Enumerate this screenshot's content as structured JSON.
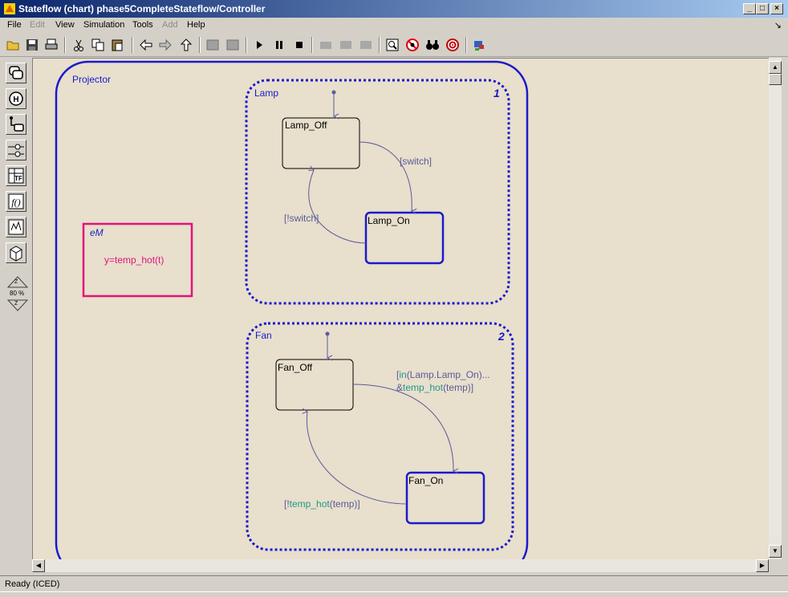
{
  "window": {
    "title": "Stateflow (chart) phase5CompleteStateflow/Controller",
    "minimize_glyph": "_",
    "maximize_glyph": "□",
    "close_glyph": "×"
  },
  "menu": {
    "items": [
      {
        "label": "File",
        "enabled": true
      },
      {
        "label": "Edit",
        "enabled": false
      },
      {
        "label": "View",
        "enabled": true
      },
      {
        "label": "Simulation",
        "enabled": true
      },
      {
        "label": "Tools",
        "enabled": true
      },
      {
        "label": "Add",
        "enabled": false
      },
      {
        "label": "Help",
        "enabled": true
      }
    ],
    "chevron": "↘"
  },
  "toolbar": {
    "icons": [
      "open-folder-icon",
      "save-icon",
      "print-icon",
      "cut-icon",
      "copy-icon",
      "paste-icon",
      "back-arrow-icon",
      "forward-arrow-icon",
      "up-arrow-icon",
      "build-icon",
      "rebuild-icon",
      "start-icon",
      "pause-icon",
      "stop-icon",
      "debug-icon",
      "explore-icon",
      "target-icon",
      "find-icon",
      "stop-sign-icon",
      "binoculars-icon",
      "explorer-icon",
      "target-builder-icon"
    ]
  },
  "palette": {
    "tools": [
      "state-tool-icon",
      "history-junction-icon",
      "default-transition-icon",
      "connective-junction-icon",
      "truth-table-icon",
      "graphical-function-icon",
      "embedded-matlab-icon",
      "box-icon"
    ],
    "zoom_level": "80 %",
    "zoom_in_glyph": "Z",
    "zoom_out_glyph": "Z"
  },
  "chart": {
    "projector": {
      "name": "Projector"
    },
    "em_function": {
      "title": "eM",
      "body": "y=temp_hot(t)"
    },
    "lamp": {
      "name": "Lamp",
      "order": "1",
      "off_state": "Lamp_Off",
      "on_state": "Lamp_On",
      "t_on": "[switch]",
      "t_off": "[!switch]"
    },
    "fan": {
      "name": "Fan",
      "order": "2",
      "off_state": "Fan_Off",
      "on_state": "Fan_On",
      "t_on_line1_a": "[",
      "t_on_line1_b": "in",
      "t_on_line1_c": "(Lamp.Lamp_On)...",
      "t_on_line2_a": "&",
      "t_on_line2_b": "temp_hot",
      "t_on_line2_c": "(temp)]",
      "t_off_a": "[!",
      "t_off_b": "temp_hot",
      "t_off_c": "(temp)]"
    }
  },
  "status": {
    "text": "Ready (ICED)"
  },
  "colors": {
    "canvas": "#e8dfcc",
    "state_blue": "#1a1acc",
    "em_pink": "#e0147a",
    "transition": "#5a5a9c"
  }
}
